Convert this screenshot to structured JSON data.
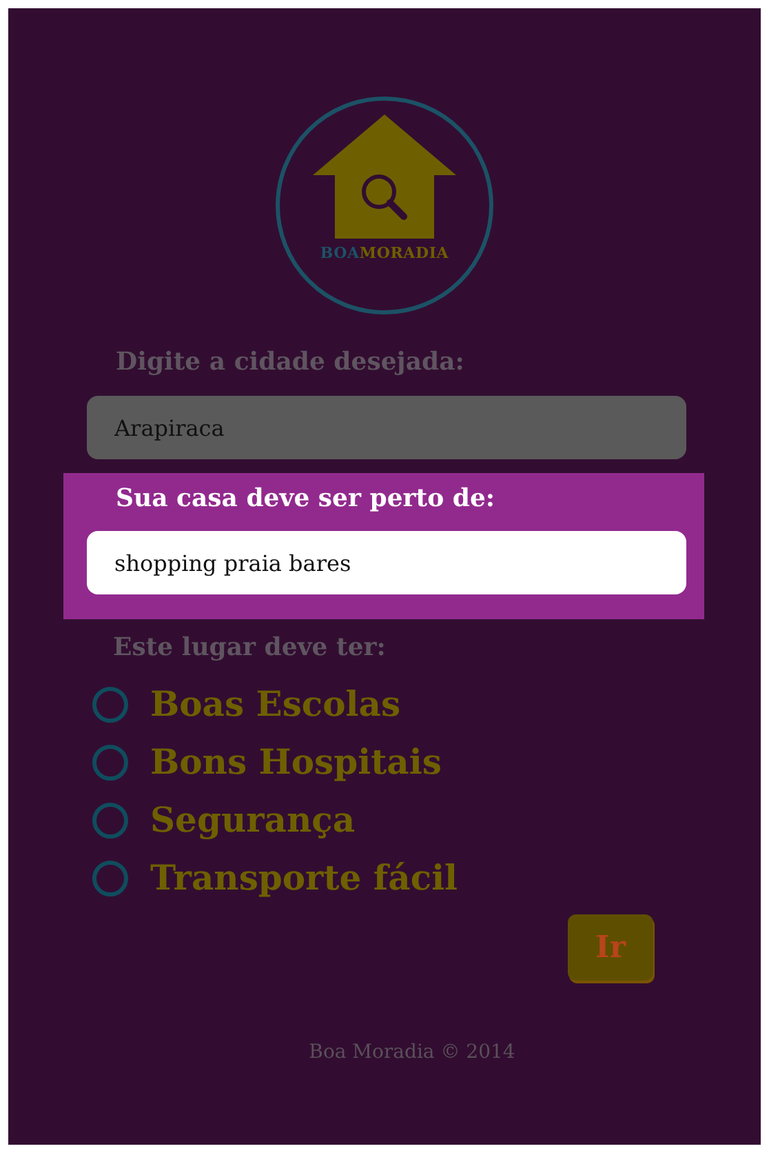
{
  "logo": {
    "parts": [
      {
        "text": "BOA",
        "color": "#1c5266"
      },
      {
        "text": "MORADIA",
        "color": "#6e6000"
      }
    ]
  },
  "city": {
    "label": "Digite a cidade desejada:",
    "value": "Arapiraca"
  },
  "near": {
    "label": "Sua casa deve ser perto de:",
    "value": "shopping praia bares"
  },
  "features": {
    "label": "Este lugar deve ter:",
    "options": [
      {
        "label": "Boas Escolas",
        "checked": false
      },
      {
        "label": "Bons Hospitais",
        "checked": false
      },
      {
        "label": "Segurança",
        "checked": false
      },
      {
        "label": "Transporte fácil",
        "checked": false
      }
    ]
  },
  "submit": "Ir",
  "footer": "Boa Moradia © 2014"
}
